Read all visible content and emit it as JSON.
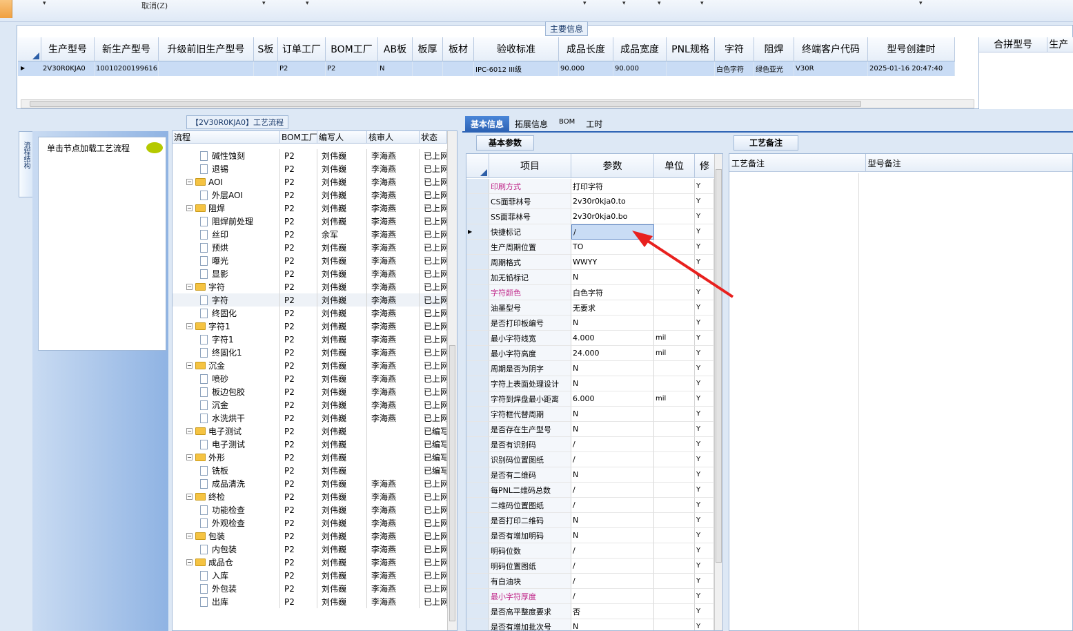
{
  "toolbar": {
    "cancel": "取消(Z)"
  },
  "main_info": {
    "title": "主要信息",
    "columns": [
      "生产型号",
      "新生产型号",
      "升级前旧生产型号",
      "S板",
      "订单工厂",
      "BOM工厂",
      "AB板",
      "板厚",
      "板材",
      "验收标准",
      "成品长度",
      "成品宽度",
      "PNL规格",
      "字符",
      "阻焊",
      "终端客户代码",
      "型号创建时"
    ],
    "row": [
      "2V30R0KJA0",
      "10010200199616",
      "",
      "",
      "P2",
      "P2",
      "N",
      "",
      "",
      "IPC-6012 III级",
      "90.000",
      "90.000",
      "",
      "白色字符",
      "绿色亚光",
      "V30R",
      "2025-01-16 20:47:40"
    ],
    "merge_headers": [
      "合拼型号",
      "生产"
    ]
  },
  "left": {
    "flow_title": "【2V30R0KJA0】工艺流程",
    "side_tab": "流程结构",
    "load_hint": "单击节点加载工艺流程",
    "tree_headers": [
      "流程",
      "BOM工厂",
      "编写人",
      "核审人",
      "状态"
    ],
    "rows": [
      {
        "d": 1,
        "f": 0,
        "name": "碱性蚀刻",
        "bom": "P2",
        "w": "刘伟巍",
        "r": "李海燕",
        "s": "已上网"
      },
      {
        "d": 1,
        "f": 0,
        "name": "退锡",
        "bom": "P2",
        "w": "刘伟巍",
        "r": "李海燕",
        "s": "已上网"
      },
      {
        "d": 0,
        "f": 1,
        "name": "AOI",
        "bom": "P2",
        "w": "刘伟巍",
        "r": "李海燕",
        "s": "已上网"
      },
      {
        "d": 1,
        "f": 0,
        "name": "外层AOI",
        "bom": "P2",
        "w": "刘伟巍",
        "r": "李海燕",
        "s": "已上网"
      },
      {
        "d": 0,
        "f": 1,
        "name": "阻焊",
        "bom": "P2",
        "w": "刘伟巍",
        "r": "李海燕",
        "s": "已上网"
      },
      {
        "d": 1,
        "f": 0,
        "name": "阻焊前处理",
        "bom": "P2",
        "w": "刘伟巍",
        "r": "李海燕",
        "s": "已上网"
      },
      {
        "d": 1,
        "f": 0,
        "name": "丝印",
        "bom": "P2",
        "w": "余军",
        "r": "李海燕",
        "s": "已上网"
      },
      {
        "d": 1,
        "f": 0,
        "name": "预烘",
        "bom": "P2",
        "w": "刘伟巍",
        "r": "李海燕",
        "s": "已上网"
      },
      {
        "d": 1,
        "f": 0,
        "name": "曝光",
        "bom": "P2",
        "w": "刘伟巍",
        "r": "李海燕",
        "s": "已上网"
      },
      {
        "d": 1,
        "f": 0,
        "name": "显影",
        "bom": "P2",
        "w": "刘伟巍",
        "r": "李海燕",
        "s": "已上网"
      },
      {
        "d": 0,
        "f": 1,
        "name": "字符",
        "bom": "P2",
        "w": "刘伟巍",
        "r": "李海燕",
        "s": "已上网"
      },
      {
        "d": 1,
        "f": 0,
        "name": "字符",
        "bom": "P2",
        "w": "刘伟巍",
        "r": "李海燕",
        "s": "已上网"
      },
      {
        "d": 1,
        "f": 0,
        "name": "终固化",
        "bom": "P2",
        "w": "刘伟巍",
        "r": "李海燕",
        "s": "已上网"
      },
      {
        "d": 0,
        "f": 1,
        "name": "字符1",
        "bom": "P2",
        "w": "刘伟巍",
        "r": "李海燕",
        "s": "已上网"
      },
      {
        "d": 1,
        "f": 0,
        "name": "字符1",
        "bom": "P2",
        "w": "刘伟巍",
        "r": "李海燕",
        "s": "已上网"
      },
      {
        "d": 1,
        "f": 0,
        "name": "终固化1",
        "bom": "P2",
        "w": "刘伟巍",
        "r": "李海燕",
        "s": "已上网"
      },
      {
        "d": 0,
        "f": 1,
        "name": "沉金",
        "bom": "P2",
        "w": "刘伟巍",
        "r": "李海燕",
        "s": "已上网"
      },
      {
        "d": 1,
        "f": 0,
        "name": "喷砂",
        "bom": "P2",
        "w": "刘伟巍",
        "r": "李海燕",
        "s": "已上网"
      },
      {
        "d": 1,
        "f": 0,
        "name": "板边包胶",
        "bom": "P2",
        "w": "刘伟巍",
        "r": "李海燕",
        "s": "已上网"
      },
      {
        "d": 1,
        "f": 0,
        "name": "沉金",
        "bom": "P2",
        "w": "刘伟巍",
        "r": "李海燕",
        "s": "已上网"
      },
      {
        "d": 1,
        "f": 0,
        "name": "水洗烘干",
        "bom": "P2",
        "w": "刘伟巍",
        "r": "李海燕",
        "s": "已上网"
      },
      {
        "d": 0,
        "f": 1,
        "name": "电子测试",
        "bom": "P2",
        "w": "刘伟巍",
        "r": "",
        "s": "已编写"
      },
      {
        "d": 1,
        "f": 0,
        "name": "电子测试",
        "bom": "P2",
        "w": "刘伟巍",
        "r": "",
        "s": "已编写"
      },
      {
        "d": 0,
        "f": 1,
        "name": "外形",
        "bom": "P2",
        "w": "刘伟巍",
        "r": "",
        "s": "已编写"
      },
      {
        "d": 1,
        "f": 0,
        "name": "铣板",
        "bom": "P2",
        "w": "刘伟巍",
        "r": "",
        "s": "已编写"
      },
      {
        "d": 1,
        "f": 0,
        "name": "成品清洗",
        "bom": "P2",
        "w": "刘伟巍",
        "r": "李海燕",
        "s": "已上网"
      },
      {
        "d": 0,
        "f": 1,
        "name": "终检",
        "bom": "P2",
        "w": "刘伟巍",
        "r": "李海燕",
        "s": "已上网"
      },
      {
        "d": 1,
        "f": 0,
        "name": "功能检查",
        "bom": "P2",
        "w": "刘伟巍",
        "r": "李海燕",
        "s": "已上网"
      },
      {
        "d": 1,
        "f": 0,
        "name": "外观检查",
        "bom": "P2",
        "w": "刘伟巍",
        "r": "李海燕",
        "s": "已上网"
      },
      {
        "d": 0,
        "f": 1,
        "name": "包装",
        "bom": "P2",
        "w": "刘伟巍",
        "r": "李海燕",
        "s": "已上网"
      },
      {
        "d": 1,
        "f": 0,
        "name": "内包装",
        "bom": "P2",
        "w": "刘伟巍",
        "r": "李海燕",
        "s": "已上网"
      },
      {
        "d": 0,
        "f": 1,
        "name": "成品仓",
        "bom": "P2",
        "w": "刘伟巍",
        "r": "李海燕",
        "s": "已上网"
      },
      {
        "d": 1,
        "f": 0,
        "name": "入库",
        "bom": "P2",
        "w": "刘伟巍",
        "r": "李海燕",
        "s": "已上网"
      },
      {
        "d": 1,
        "f": 0,
        "name": "外包装",
        "bom": "P2",
        "w": "刘伟巍",
        "r": "李海燕",
        "s": "已上网"
      },
      {
        "d": 1,
        "f": 0,
        "name": "出库",
        "bom": "P2",
        "w": "刘伟巍",
        "r": "李海燕",
        "s": "已上网"
      }
    ]
  },
  "right": {
    "tabs": [
      "基本信息",
      "拓展信息",
      "BOM",
      "工时"
    ],
    "param_tab": "基本参数",
    "notes_tab": "工艺备注",
    "param_headers": [
      "项目",
      "参数",
      "单位",
      "修"
    ],
    "notes_headers": [
      "工艺备注",
      "型号备注"
    ],
    "params": [
      [
        "印刷方式",
        "打印字符",
        "",
        "Y",
        1
      ],
      [
        "CS面菲林号",
        "2v30r0kja0.to",
        "",
        "Y",
        0
      ],
      [
        "SS面菲林号",
        "2v30r0kja0.bo",
        "",
        "Y",
        0
      ],
      [
        "快捷标记",
        "/",
        "",
        "Y",
        0
      ],
      [
        "生产周期位置",
        "TO",
        "",
        "Y",
        0
      ],
      [
        "周期格式",
        "WWYY",
        "",
        "Y",
        0
      ],
      [
        "加无铅标记",
        "N",
        "",
        "Y",
        0
      ],
      [
        "字符颜色",
        "白色字符",
        "",
        "Y",
        1
      ],
      [
        "油墨型号",
        "无要求",
        "",
        "Y",
        0
      ],
      [
        "是否打印板编号",
        "N",
        "",
        "Y",
        0
      ],
      [
        "最小字符线宽",
        "4.000",
        "mil",
        "Y",
        0
      ],
      [
        "最小字符高度",
        "24.000",
        "mil",
        "Y",
        0
      ],
      [
        "周期是否为阴字",
        "N",
        "",
        "Y",
        0
      ],
      [
        "字符上表面处理设计",
        "N",
        "",
        "Y",
        0
      ],
      [
        "字符到焊盘最小距离",
        "6.000",
        "mil",
        "Y",
        0
      ],
      [
        "字符框代替周期",
        "N",
        "",
        "Y",
        0
      ],
      [
        "是否存在生产型号",
        "N",
        "",
        "Y",
        0
      ],
      [
        "是否有识别码",
        "/",
        "",
        "Y",
        0
      ],
      [
        "识别码位置图纸",
        "/",
        "",
        "Y",
        0
      ],
      [
        "是否有二维码",
        "N",
        "",
        "Y",
        0
      ],
      [
        "每PNL二维码总数",
        "/",
        "",
        "Y",
        0
      ],
      [
        "二维码位置图纸",
        "/",
        "",
        "Y",
        0
      ],
      [
        "是否打印二维码",
        "N",
        "",
        "Y",
        0
      ],
      [
        "是否有增加明码",
        "N",
        "",
        "Y",
        0
      ],
      [
        "明码位数",
        "/",
        "",
        "Y",
        0
      ],
      [
        "明码位置图纸",
        "/",
        "",
        "Y",
        0
      ],
      [
        "有白油块",
        "/",
        "",
        "Y",
        0
      ],
      [
        "最小字符厚度",
        "/",
        "",
        "Y",
        1
      ],
      [
        "是否高平整度要求",
        "否",
        "",
        "Y",
        0
      ],
      [
        "是否有增加批次号",
        "N",
        "",
        "Y",
        0
      ]
    ]
  }
}
